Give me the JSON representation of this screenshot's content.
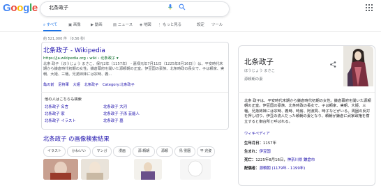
{
  "header": {
    "logo_letters": [
      "G",
      "o",
      "o",
      "g",
      "l",
      "e"
    ],
    "logo_colors": [
      "#4285f4",
      "#ea4335",
      "#fbbc05",
      "#4285f4",
      "#34a853",
      "#ea4335"
    ],
    "search_value": "北条政子"
  },
  "tabs": {
    "all": "すべて",
    "images": "画像",
    "videos": "動画",
    "news": "ニュース",
    "maps": "地図",
    "more": "もっと見る",
    "settings": "設定",
    "tools": "ツール"
  },
  "stats": "約 521,000 件 （0.56 秒）",
  "result": {
    "title": "北条政子 - Wikipedia",
    "url": "https://ja.wikipedia.org › wiki › 北条政子 ▾",
    "snippet": "北条 政子（ほうじょう まさこ、保元2年（1157年） - 嘉禄元年7月11日（1225年8月16日））は、平安時代末期から鎌倉時代初期の女性。鎌倉幕府を開いた源頼朝の正室。伊豆国の豪族、北条時政の長女で、子は頼家、実朝、大姫、三幡。兄弟姉妹には宗時、義...",
    "sitelinks": [
      "亀の前",
      "尼将軍",
      "大姫",
      "北条政子",
      "Category:北条政子"
    ]
  },
  "related": {
    "heading": "他の人はこちらも検索",
    "items": [
      "北条政子 名言",
      "北条政子 家",
      "北条政子 イラスト",
      "北条政子 大河",
      "北条政子 子孫 芸能人",
      "北条政子 墓"
    ]
  },
  "images": {
    "title": "北条政子 の画像検索結果",
    "chips": [
      "イラスト",
      "かわいい",
      "マンガ",
      "漫画",
      "源 頼朝",
      "源頼",
      "鳥 霊園",
      "平 兆姿"
    ]
  },
  "panel": {
    "name": "北条政子",
    "reading": "ほうじょう まさこ",
    "description": "源頼朝の妻",
    "bio": "北条 政子は、平安時代末期から鎌倉時代初期の女性。鎌倉幕府を開いた源頼朝の正室。伊豆国の豪族、北条時政の長女で、子は頼家、実朝、大姫、三幡。兄弟姉妹には宗時、義時、時房、阿波局、時子などがいる。周囲の反対を押し切り、伊豆の流人だった頼朝の妻となり、頼朝が鎌倉に武家政権を樹立すると御台所と呼ばれる。",
    "wiki_link": "ウィキペディア",
    "facts": [
      {
        "label": "生年月日：",
        "value": "1157年",
        "link": ""
      },
      {
        "label": "生まれ：",
        "value": "",
        "link": "伊豆国"
      },
      {
        "label": "死亡：",
        "value": "1225年8月16日，",
        "link": "神奈川県 鎌倉市"
      },
      {
        "label": "配偶者：",
        "value": "",
        "link": "源頼朝 (1179年 - 1199年)"
      }
    ]
  },
  "colors": {
    "link": "#1a0dab",
    "url_green": "#006621",
    "accent": "#1a73e8"
  }
}
